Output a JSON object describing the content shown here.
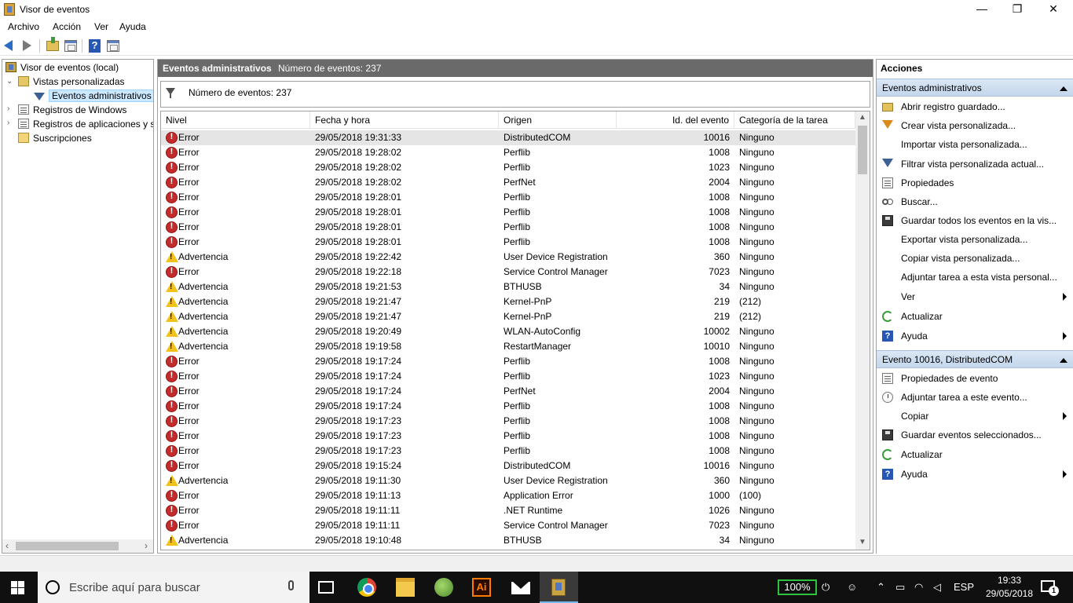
{
  "window": {
    "title": "Visor de eventos",
    "minimize": "—",
    "maximize": "❐",
    "close": "✕"
  },
  "menu": [
    "Archivo",
    "Acción",
    "Ver",
    "Ayuda"
  ],
  "tree": {
    "root": "Visor de eventos (local)",
    "custom_views": "Vistas personalizadas",
    "admin_events": "Eventos administrativos",
    "windows_logs": "Registros de Windows",
    "app_logs": "Registros de aplicaciones y s",
    "subscriptions": "Suscripciones"
  },
  "center": {
    "title": "Eventos administrativos",
    "count": "Número de eventos: 237",
    "filter_text": "Número de eventos: 237",
    "columns": [
      "Nivel",
      "Fecha y hora",
      "Origen",
      "Id. del evento",
      "Categoría de la tarea"
    ]
  },
  "events": [
    {
      "level": "Error",
      "datetime": "29/05/2018 19:31:33",
      "source": "DistributedCOM",
      "id": "10016",
      "category": "Ninguno"
    },
    {
      "level": "Error",
      "datetime": "29/05/2018 19:28:02",
      "source": "Perflib",
      "id": "1008",
      "category": "Ninguno"
    },
    {
      "level": "Error",
      "datetime": "29/05/2018 19:28:02",
      "source": "Perflib",
      "id": "1023",
      "category": "Ninguno"
    },
    {
      "level": "Error",
      "datetime": "29/05/2018 19:28:02",
      "source": "PerfNet",
      "id": "2004",
      "category": "Ninguno"
    },
    {
      "level": "Error",
      "datetime": "29/05/2018 19:28:01",
      "source": "Perflib",
      "id": "1008",
      "category": "Ninguno"
    },
    {
      "level": "Error",
      "datetime": "29/05/2018 19:28:01",
      "source": "Perflib",
      "id": "1008",
      "category": "Ninguno"
    },
    {
      "level": "Error",
      "datetime": "29/05/2018 19:28:01",
      "source": "Perflib",
      "id": "1008",
      "category": "Ninguno"
    },
    {
      "level": "Error",
      "datetime": "29/05/2018 19:28:01",
      "source": "Perflib",
      "id": "1008",
      "category": "Ninguno"
    },
    {
      "level": "Advertencia",
      "datetime": "29/05/2018 19:22:42",
      "source": "User Device Registration",
      "id": "360",
      "category": "Ninguno"
    },
    {
      "level": "Error",
      "datetime": "29/05/2018 19:22:18",
      "source": "Service Control Manager",
      "id": "7023",
      "category": "Ninguno"
    },
    {
      "level": "Advertencia",
      "datetime": "29/05/2018 19:21:53",
      "source": "BTHUSB",
      "id": "34",
      "category": "Ninguno"
    },
    {
      "level": "Advertencia",
      "datetime": "29/05/2018 19:21:47",
      "source": "Kernel-PnP",
      "id": "219",
      "category": "(212)"
    },
    {
      "level": "Advertencia",
      "datetime": "29/05/2018 19:21:47",
      "source": "Kernel-PnP",
      "id": "219",
      "category": "(212)"
    },
    {
      "level": "Advertencia",
      "datetime": "29/05/2018 19:20:49",
      "source": "WLAN-AutoConfig",
      "id": "10002",
      "category": "Ninguno"
    },
    {
      "level": "Advertencia",
      "datetime": "29/05/2018 19:19:58",
      "source": "RestartManager",
      "id": "10010",
      "category": "Ninguno"
    },
    {
      "level": "Error",
      "datetime": "29/05/2018 19:17:24",
      "source": "Perflib",
      "id": "1008",
      "category": "Ninguno"
    },
    {
      "level": "Error",
      "datetime": "29/05/2018 19:17:24",
      "source": "Perflib",
      "id": "1023",
      "category": "Ninguno"
    },
    {
      "level": "Error",
      "datetime": "29/05/2018 19:17:24",
      "source": "PerfNet",
      "id": "2004",
      "category": "Ninguno"
    },
    {
      "level": "Error",
      "datetime": "29/05/2018 19:17:24",
      "source": "Perflib",
      "id": "1008",
      "category": "Ninguno"
    },
    {
      "level": "Error",
      "datetime": "29/05/2018 19:17:23",
      "source": "Perflib",
      "id": "1008",
      "category": "Ninguno"
    },
    {
      "level": "Error",
      "datetime": "29/05/2018 19:17:23",
      "source": "Perflib",
      "id": "1008",
      "category": "Ninguno"
    },
    {
      "level": "Error",
      "datetime": "29/05/2018 19:17:23",
      "source": "Perflib",
      "id": "1008",
      "category": "Ninguno"
    },
    {
      "level": "Error",
      "datetime": "29/05/2018 19:15:24",
      "source": "DistributedCOM",
      "id": "10016",
      "category": "Ninguno"
    },
    {
      "level": "Advertencia",
      "datetime": "29/05/2018 19:11:30",
      "source": "User Device Registration",
      "id": "360",
      "category": "Ninguno"
    },
    {
      "level": "Error",
      "datetime": "29/05/2018 19:11:13",
      "source": "Application Error",
      "id": "1000",
      "category": "(100)"
    },
    {
      "level": "Error",
      "datetime": "29/05/2018 19:11:11",
      "source": ".NET Runtime",
      "id": "1026",
      "category": "Ninguno"
    },
    {
      "level": "Error",
      "datetime": "29/05/2018 19:11:11",
      "source": "Service Control Manager",
      "id": "7023",
      "category": "Ninguno"
    },
    {
      "level": "Advertencia",
      "datetime": "29/05/2018 19:10:48",
      "source": "BTHUSB",
      "id": "34",
      "category": "Ninguno"
    }
  ],
  "actions": {
    "header": "Acciones",
    "section1": {
      "title": "Eventos administrativos",
      "items": [
        {
          "label": "Abrir registro guardado...",
          "icon": "open-folder-icon"
        },
        {
          "label": "Crear vista personalizada...",
          "icon": "filter-create-icon"
        },
        {
          "label": "Importar vista personalizada...",
          "icon": ""
        },
        {
          "label": "Filtrar vista personalizada actual...",
          "icon": "filter-icon"
        },
        {
          "label": "Propiedades",
          "icon": "properties-icon"
        },
        {
          "label": "Buscar...",
          "icon": "binoculars-icon"
        },
        {
          "label": "Guardar todos los eventos en la vis...",
          "icon": "save-icon"
        },
        {
          "label": "Exportar vista personalizada...",
          "icon": ""
        },
        {
          "label": "Copiar vista personalizada...",
          "icon": ""
        },
        {
          "label": "Adjuntar tarea a esta vista personal...",
          "icon": ""
        },
        {
          "label": "Ver",
          "icon": "",
          "submenu": true
        },
        {
          "label": "Actualizar",
          "icon": "refresh-icon"
        },
        {
          "label": "Ayuda",
          "icon": "help-icon",
          "submenu": true
        }
      ]
    },
    "section2": {
      "title": "Evento 10016, DistributedCOM",
      "items": [
        {
          "label": "Propiedades de evento",
          "icon": "properties-icon"
        },
        {
          "label": "Adjuntar tarea a este evento...",
          "icon": "task-icon"
        },
        {
          "label": "Copiar",
          "icon": "",
          "submenu": true
        },
        {
          "label": "Guardar eventos seleccionados...",
          "icon": "save-icon"
        },
        {
          "label": "Actualizar",
          "icon": "refresh-icon"
        },
        {
          "label": "Ayuda",
          "icon": "help-icon",
          "submenu": true
        }
      ]
    }
  },
  "taskbar": {
    "search_placeholder": "Escribe aquí para buscar",
    "battery": "100%",
    "language": "ESP",
    "time": "19:33",
    "date": "29/05/2018",
    "notifications": "1",
    "illustrator": "Ai"
  },
  "colors": {
    "selection": "#cce8ff",
    "header_gray": "#6a6a6a",
    "section_blue": "#c3d6ec",
    "error_red": "#c42b2b",
    "warning_yellow": "#f2c21b"
  }
}
